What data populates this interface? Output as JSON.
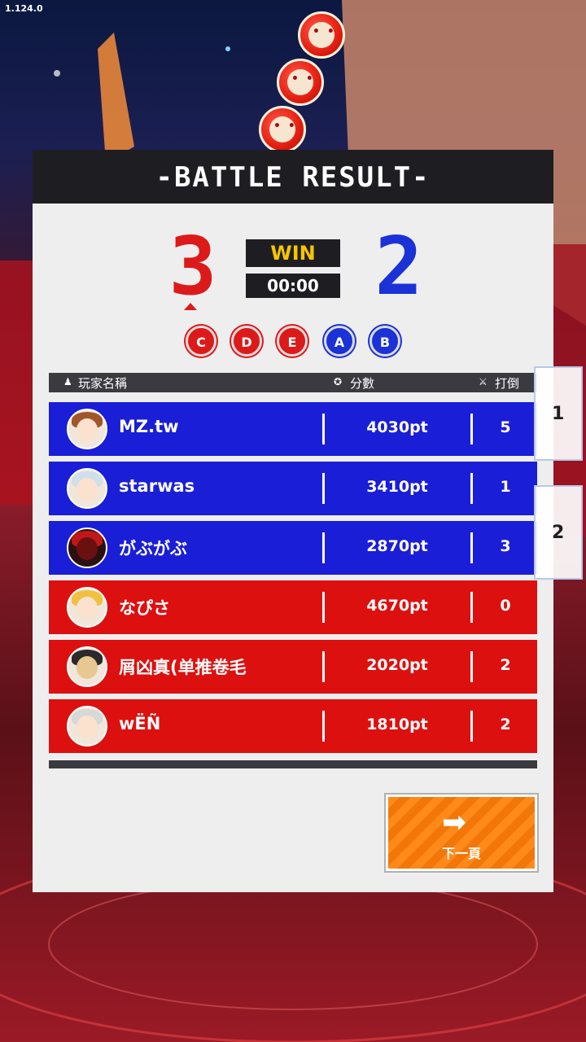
{
  "version": "1.124.0",
  "title": "-BATTLE RESULT-",
  "match": {
    "red_score": "3",
    "blue_score": "2",
    "result": "WIN",
    "time": "00:00"
  },
  "ranks": [
    {
      "letter": "C",
      "team": "red"
    },
    {
      "letter": "D",
      "team": "red"
    },
    {
      "letter": "E",
      "team": "red"
    },
    {
      "letter": "A",
      "team": "blue"
    },
    {
      "letter": "B",
      "team": "blue"
    }
  ],
  "columns": {
    "player": "玩家名稱",
    "score": "分數",
    "kills": "打倒"
  },
  "players": [
    {
      "name": "MZ.tw",
      "score": "4030pt",
      "kills": "5",
      "team": "blue",
      "avatar": "brown-hair-girl-avatar"
    },
    {
      "name": "starwas",
      "score": "3410pt",
      "kills": "1",
      "team": "blue",
      "avatar": "white-hair-girl-avatar"
    },
    {
      "name": "がぶがぶ",
      "score": "2870pt",
      "kills": "3",
      "team": "blue",
      "avatar": "red-mech-avatar"
    },
    {
      "name": "なぴさ",
      "score": "4670pt",
      "kills": "0",
      "team": "red",
      "avatar": "blonde-girl-avatar"
    },
    {
      "name": "屑凶真(单推卷毛",
      "score": "2020pt",
      "kills": "2",
      "team": "red",
      "avatar": "witch-hat-avatar"
    },
    {
      "name": "wËÑ",
      "score": "1810pt",
      "kills": "2",
      "team": "red",
      "avatar": "silver-hair-girl-avatar"
    }
  ],
  "next_button": {
    "label": "下一頁"
  },
  "team_tabs": [
    {
      "label": "1"
    },
    {
      "label": "2"
    }
  ],
  "colors": {
    "red": "#dd1010",
    "blue": "#1a1ed6",
    "accent": "#f5c500",
    "button": "#ff8a1a"
  }
}
